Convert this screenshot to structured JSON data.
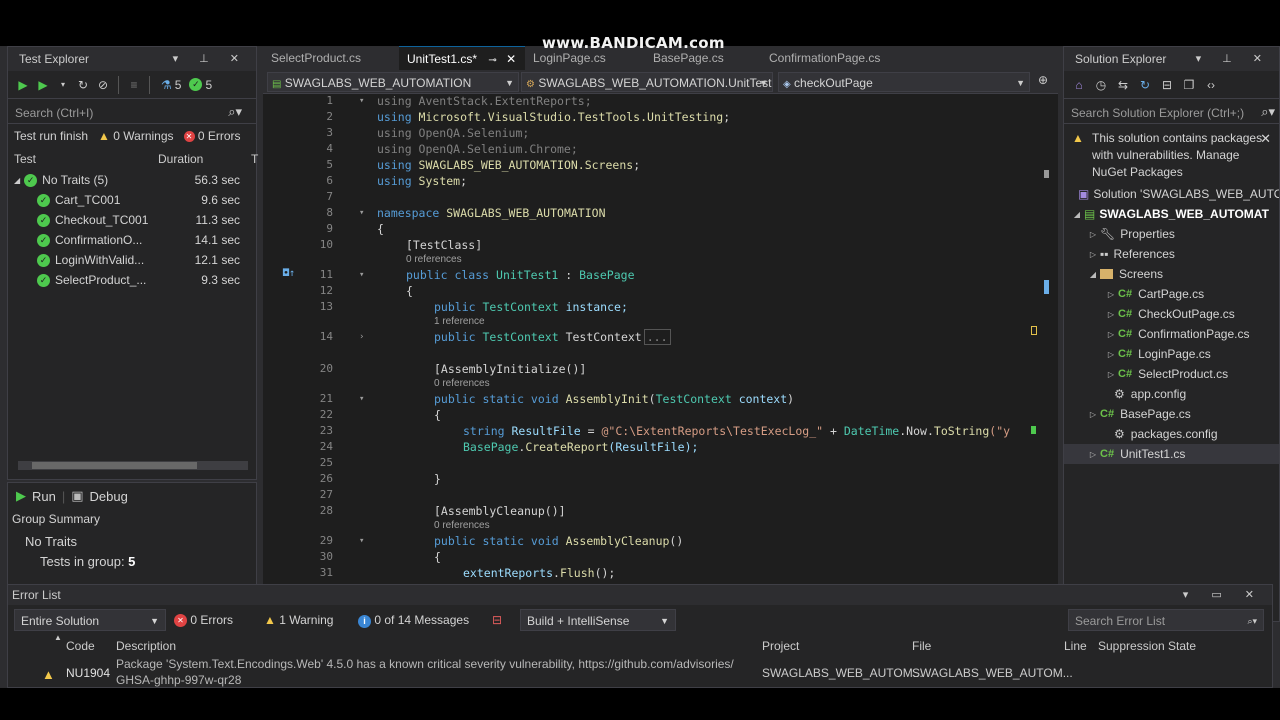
{
  "watermark": "www.BANDICAM.com",
  "test_explorer": {
    "title": "Test Explorer",
    "passed_count": "5",
    "total_count": "5",
    "search_placeholder": "Search (Ctrl+I)",
    "status_text": "Test run finish",
    "warnings": "0 Warnings",
    "errors": "0 Errors",
    "col_test": "Test",
    "col_duration": "Duration",
    "col_traits": "T",
    "group": {
      "label": "No Traits (5)",
      "duration": "56.3 sec"
    },
    "tests": [
      {
        "name": "Cart_TC001",
        "duration": "9.6 sec"
      },
      {
        "name": "Checkout_TC001",
        "duration": "11.3 sec"
      },
      {
        "name": "ConfirmationO...",
        "duration": "14.1 sec"
      },
      {
        "name": "LoginWithValid...",
        "duration": "12.1 sec"
      },
      {
        "name": "SelectProduct_...",
        "duration": "9.3 sec"
      }
    ],
    "run_label": "Run",
    "debug_label": "Debug",
    "group_summary": "Group Summary",
    "no_traits": "No Traits",
    "tests_in_group_label": "Tests in group",
    "tests_in_group_value": "5"
  },
  "editor": {
    "tabs": [
      {
        "label": "SelectProduct.cs"
      },
      {
        "label": "UnitTest1.cs*"
      },
      {
        "label": "LoginPage.cs"
      },
      {
        "label": "BasePage.cs"
      },
      {
        "label": "ConfirmationPage.cs"
      }
    ],
    "nav_project": "SWAGLABS_WEB_AUTOMATION",
    "nav_class": "SWAGLABS_WEB_AUTOMATION.UnitTest",
    "nav_member": "checkOutPage",
    "line_numbers": [
      "1",
      "2",
      "3",
      "4",
      "5",
      "6",
      "7",
      "8",
      "9",
      "10",
      "11",
      "12",
      "13",
      "14",
      "20",
      "21",
      "22",
      "23",
      "24",
      "25",
      "26",
      "27",
      "28",
      "29",
      "30",
      "31"
    ],
    "refs": {
      "zero": "0 references",
      "one": "1 reference"
    },
    "code": {
      "l1": "using AventStack.ExtentReports;",
      "l2a": "using ",
      "l2b": "Microsoft.VisualStudio.TestTools.UnitTesting",
      "l2c": ";",
      "l3": "using OpenQA.Selenium;",
      "l4": "using OpenQA.Selenium.Chrome;",
      "l5a": "using ",
      "l5b": "SWAGLABS_WEB_AUTOMATION.Screens",
      "l5c": ";",
      "l6a": "using ",
      "l6b": "System",
      "l6c": ";",
      "l8a": "namespace ",
      "l8b": "SWAGLABS_WEB_AUTOMATION",
      "brace_open": "{",
      "brace_close": "}",
      "l10": "[TestClass]",
      "l11a": "public class ",
      "l11b": "UnitTest1",
      "l11c": " : ",
      "l11d": "BasePage",
      "l13a": "public ",
      "l13b": "TestContext",
      "l13c": " instance;",
      "l14a": "public ",
      "l14b": "TestContext",
      "l14c": " TestContext",
      "l14d": "...",
      "l20": "[AssemblyInitialize()]",
      "l21a": "public static void ",
      "l21b": "AssemblyInit",
      "l21c": "(",
      "l21d": "TestContext",
      "l21e": " context",
      "l21f": ")",
      "l23a": "string ",
      "l23b": "ResultFile",
      "l23c": " = ",
      "l23d": "@\"C:\\ExtentReports\\TestExecLog_\"",
      "l23e": " + ",
      "l23f": "DateTime",
      "l23g": ".",
      "l23h": "Now",
      "l23i": ".",
      "l23j": "ToString",
      "l23k": "(\"y",
      "l24a": "BasePage",
      "l24b": ".",
      "l24c": "CreateReport",
      "l24d": "(ResultFile);",
      "l28": "[AssemblyCleanup()]",
      "l29a": "public static void ",
      "l29b": "AssemblyCleanup",
      "l29c": "()",
      "l31a": "extentReports",
      "l31b": ".",
      "l31c": "Flush",
      "l31d": "();"
    }
  },
  "solution_explorer": {
    "title": "Solution Explorer",
    "search_placeholder": "Search Solution Explorer (Ctrl+;)",
    "vuln_message": "This solution contains packages with vulnerabilities. Manage NuGet Packages",
    "items": [
      {
        "label": "Solution 'SWAGLABS_WEB_AUTOM"
      },
      {
        "label": "SWAGLABS_WEB_AUTOMAT"
      },
      {
        "label": "Properties"
      },
      {
        "label": "References"
      },
      {
        "label": "Screens"
      },
      {
        "label": "CartPage.cs"
      },
      {
        "label": "CheckOutPage.cs"
      },
      {
        "label": "ConfirmationPage.cs"
      },
      {
        "label": "LoginPage.cs"
      },
      {
        "label": "SelectProduct.cs"
      },
      {
        "label": "app.config"
      },
      {
        "label": "BasePage.cs"
      },
      {
        "label": "packages.config"
      },
      {
        "label": "UnitTest1.cs"
      }
    ]
  },
  "error_list": {
    "title": "Error List",
    "scope": "Entire Solution",
    "errors": "0 Errors",
    "warnings": "1 Warning",
    "messages": "0 of 14 Messages",
    "build_filter": "Build + IntelliSense",
    "search_placeholder": "Search Error List",
    "columns": {
      "code": "Code",
      "description": "Description",
      "project": "Project",
      "file": "File",
      "line": "Line",
      "suppression": "Suppression State"
    },
    "rows": [
      {
        "code": "NU1904",
        "description_l1": "Package 'System.Text.Encodings.Web' 4.5.0 has a known critical severity vulnerability, https://github.com/advisories/",
        "description_l2": "GHSA-ghhp-997w-qr28",
        "project": "SWAGLABS_WEB_AUTOM...",
        "file": "SWAGLABS_WEB_AUTOM..."
      }
    ]
  }
}
